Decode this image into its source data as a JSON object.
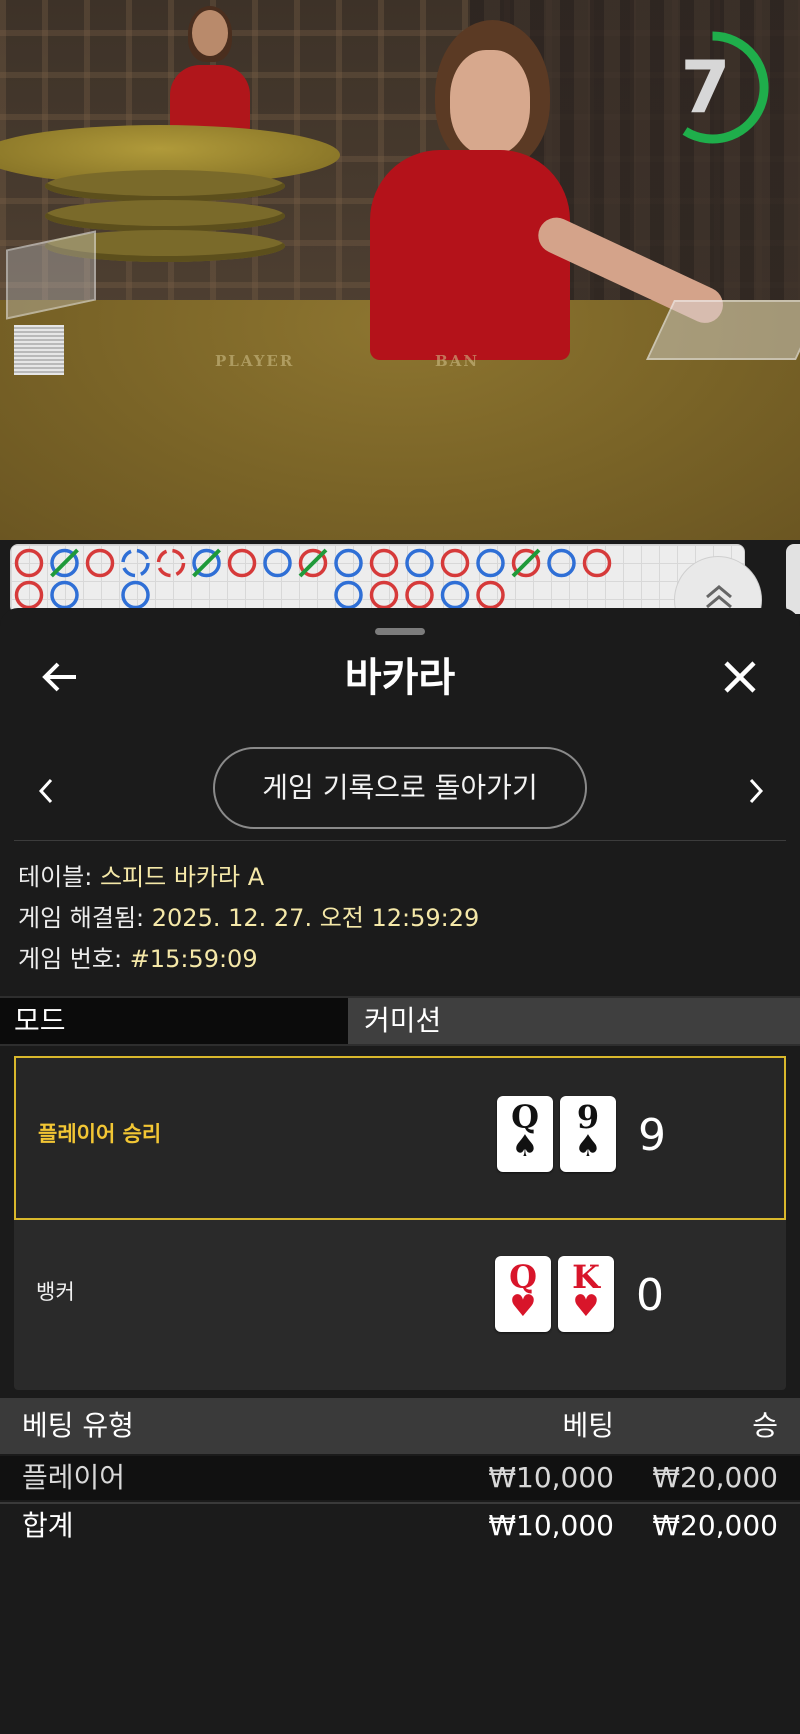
{
  "timer": {
    "value": "7",
    "color": "#1fae4b"
  },
  "video": {
    "felt_left": "PLAYER",
    "felt_right": "BAN"
  },
  "sheet": {
    "title": "바카라",
    "back_icon": "arrow-left-icon",
    "close_icon": "close-icon",
    "history_button": "게임 기록으로 돌아가기",
    "prev_icon": "chevron-left-icon",
    "next_icon": "chevron-right-icon"
  },
  "info": {
    "table_label": "테이블:",
    "table_value": "스피드 바카라 A",
    "resolved_label": "게임 해결됨:",
    "resolved_value": "2025. 12. 27. 오전 12:59:29",
    "number_label": "게임 번호:",
    "number_value": "#15:59:09"
  },
  "mode": {
    "label": "모드",
    "value": "커미션"
  },
  "result": {
    "player": {
      "label": "플레이어 승리",
      "score": "9",
      "cards": [
        {
          "rank": "Q",
          "suit": "♠",
          "color": "black"
        },
        {
          "rank": "9",
          "suit": "♠",
          "color": "black"
        }
      ]
    },
    "banker": {
      "label": "뱅커",
      "score": "0",
      "cards": [
        {
          "rank": "Q",
          "suit": "♥",
          "color": "red"
        },
        {
          "rank": "K",
          "suit": "♥",
          "color": "red"
        }
      ]
    },
    "highlight_color": "#d9b82c"
  },
  "bets": {
    "headers": {
      "type": "베팅 유형",
      "bet": "베팅",
      "win": "승"
    },
    "rows": [
      {
        "type": "플레이어",
        "bet": "₩10,000",
        "win": "₩20,000"
      }
    ],
    "total": {
      "type": "합계",
      "bet": "₩10,000",
      "win": "₩20,000"
    }
  },
  "colors": {
    "player_blue": "#2f6fd6",
    "banker_red": "#d63a3a",
    "tie_green": "#1f9a3a"
  }
}
